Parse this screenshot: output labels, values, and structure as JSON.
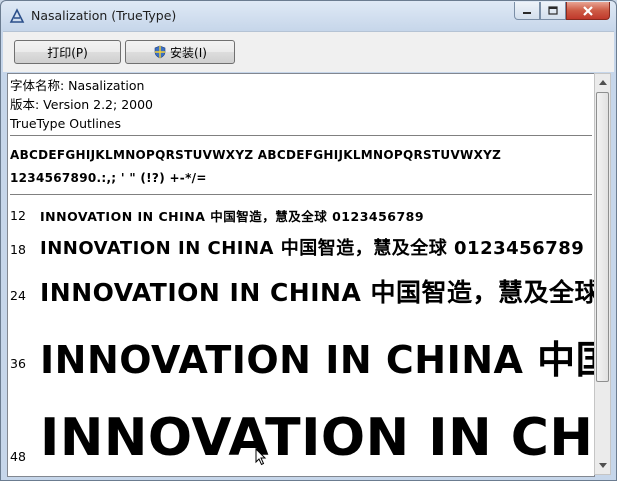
{
  "window": {
    "title": "Nasalization (TrueType)"
  },
  "toolbar": {
    "print_label": "打印(P)",
    "install_label": "安装(I)"
  },
  "font_info": {
    "name_line": "字体名称: Nasalization",
    "version_line": "版本: Version 2.2; 2000",
    "outline_line": "TrueType Outlines"
  },
  "charset": {
    "letters": "ABCDEFGHIJKLMNOPQRSTUVWXYZ ABCDEFGHIJKLMNOPQRSTUVWXYZ",
    "digits": "1234567890.:,; ' \" (!?) +-*/="
  },
  "samples": [
    {
      "size": "12",
      "text": "INNOVATION IN CHINA 中国智造，慧及全球 0123456789"
    },
    {
      "size": "18",
      "text": "INNOVATION IN CHINA 中国智造，慧及全球 0123456789"
    },
    {
      "size": "24",
      "text": "INNOVATION IN CHINA 中国智造，慧及全球"
    },
    {
      "size": "36",
      "text": "INNOVATION IN CHINA 中国智造"
    },
    {
      "size": "48",
      "text": "INNOVATION IN CHINA"
    }
  ],
  "colors": {
    "title_bar": "#c6d6ea",
    "close_button": "#c0392b",
    "content_bg": "#ffffff"
  },
  "icons": [
    "app-font-icon",
    "minimize-icon",
    "maximize-icon",
    "close-icon",
    "uac-shield-icon",
    "scroll-up-icon",
    "scroll-down-icon",
    "mouse-cursor-icon"
  ]
}
